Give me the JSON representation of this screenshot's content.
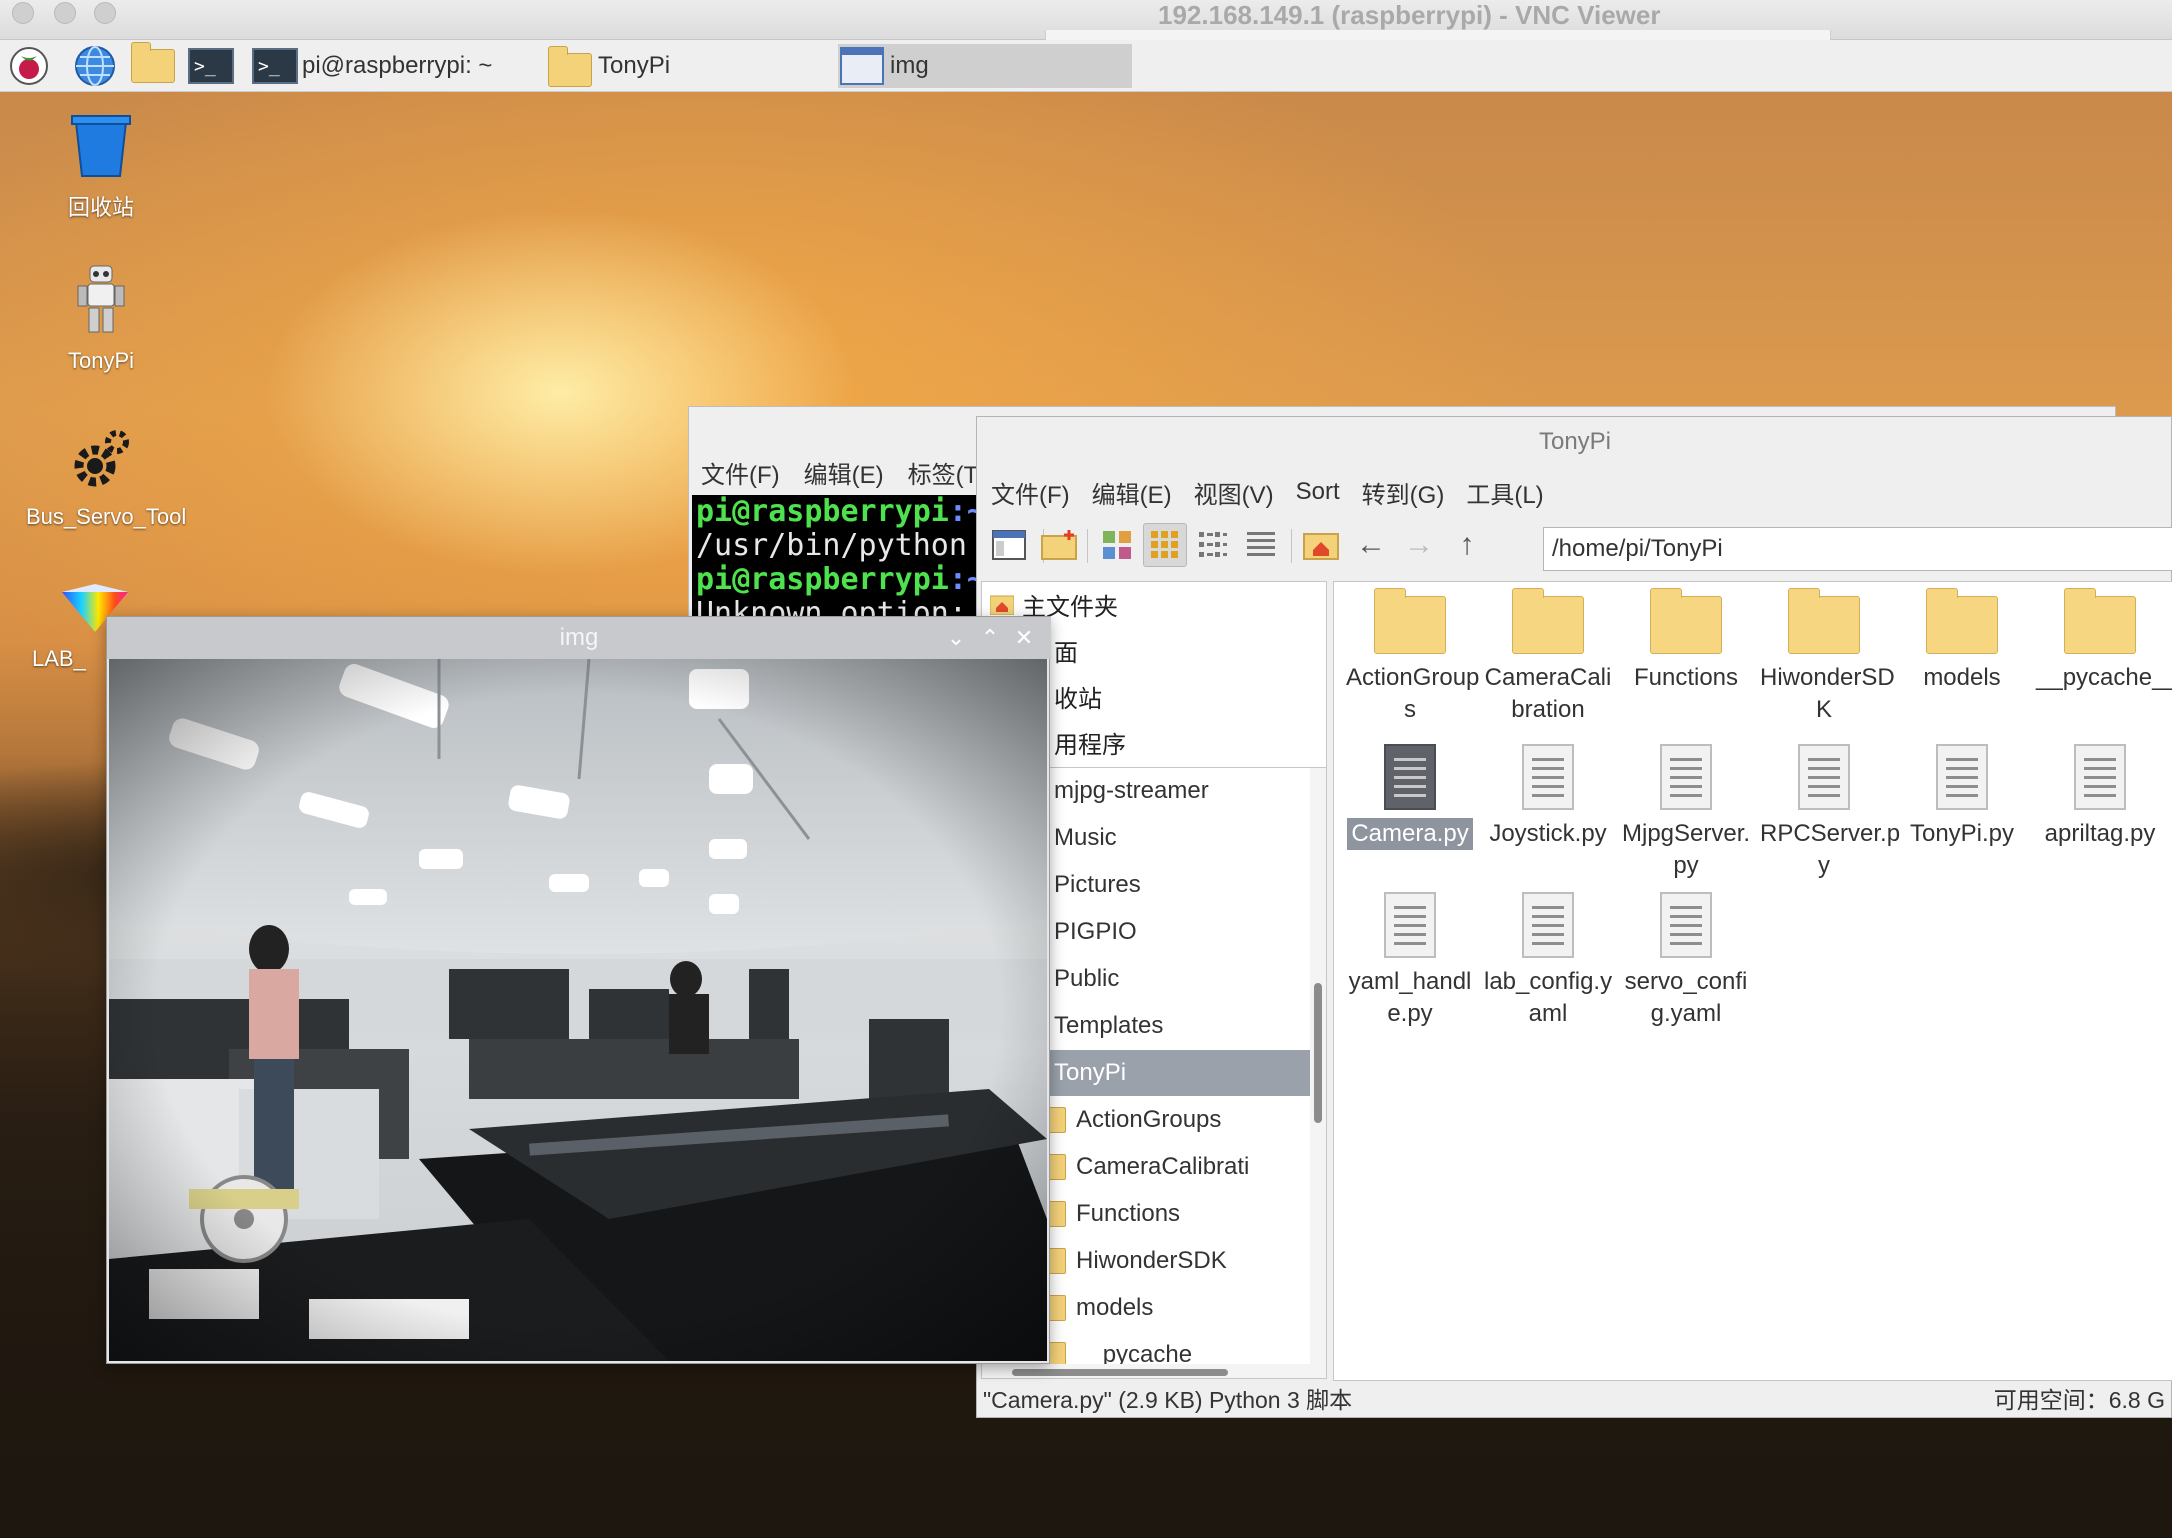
{
  "mac_window": {
    "title": "192.168.149.1 (raspberrypi) - VNC Viewer"
  },
  "taskbar": {
    "tasks": [
      {
        "label": "pi@raspberrypi: ~",
        "icon": "terminal-icon"
      },
      {
        "label": "TonyPi",
        "icon": "folder-icon"
      },
      {
        "label": "img",
        "icon": "window-icon"
      }
    ]
  },
  "desktop_icons": [
    {
      "label": "回收站",
      "icon": "trash-icon"
    },
    {
      "label": "TonyPi",
      "icon": "robot-icon"
    },
    {
      "label": "Bus_Servo_Tool",
      "icon": "gear-icon"
    },
    {
      "label": "LAB_",
      "icon": "prism-icon"
    }
  ],
  "terminal": {
    "menu": [
      "文件(F)",
      "编辑(E)",
      "标签(T)"
    ],
    "lines": [
      {
        "user": "pi@raspberrypi",
        "path": ":~"
      },
      {
        "text": "/usr/bin/python"
      },
      {
        "user": "pi@raspberrypi",
        "path": ":~"
      },
      {
        "text": "Unknown option:"
      }
    ]
  },
  "file_manager": {
    "title": "TonyPi",
    "menu": [
      "文件(F)",
      "编辑(E)",
      "视图(V)",
      "Sort",
      "转到(G)",
      "工具(L)"
    ],
    "address": "/home/pi/TonyPi",
    "places": [
      "主文件夹",
      "面",
      "收站",
      "用程序"
    ],
    "tree": [
      {
        "label": "mjpg-streamer",
        "expandable": true,
        "indent": 0
      },
      {
        "label": "Music",
        "expandable": false,
        "indent": 0,
        "glyph": "♪"
      },
      {
        "label": "Pictures",
        "expandable": false,
        "indent": 0,
        "glyph": "▲"
      },
      {
        "label": "PIGPIO",
        "expandable": true,
        "indent": 0
      },
      {
        "label": "Public",
        "expandable": false,
        "indent": 0,
        "glyph": "▪"
      },
      {
        "label": "Templates",
        "expandable": false,
        "indent": 0,
        "glyph": "▦"
      },
      {
        "label": "TonyPi",
        "expandable": true,
        "expanded": true,
        "indent": 0,
        "selected": true
      },
      {
        "label": "ActionGroups",
        "expandable": false,
        "indent": 1
      },
      {
        "label": "CameraCalibrati",
        "expandable": true,
        "indent": 1
      },
      {
        "label": "Functions",
        "expandable": true,
        "indent": 1
      },
      {
        "label": "HiwonderSDK",
        "expandable": true,
        "indent": 1
      },
      {
        "label": "models",
        "expandable": false,
        "indent": 1
      },
      {
        "label": "__pycache__",
        "expandable": false,
        "indent": 1
      }
    ],
    "files": [
      {
        "lines": [
          "ActionGroup",
          "s"
        ],
        "type": "folder"
      },
      {
        "lines": [
          "CameraCali",
          "bration"
        ],
        "type": "folder"
      },
      {
        "lines": [
          "Functions"
        ],
        "type": "folder"
      },
      {
        "lines": [
          "HiwonderSD",
          "K"
        ],
        "type": "folder"
      },
      {
        "lines": [
          "models"
        ],
        "type": "folder"
      },
      {
        "lines": [
          "__pycache__"
        ],
        "type": "folder"
      },
      {
        "lines": [
          "Camera.py"
        ],
        "type": "file",
        "selected": true
      },
      {
        "lines": [
          "Joystick.py"
        ],
        "type": "file"
      },
      {
        "lines": [
          "MjpgServer.",
          "py"
        ],
        "type": "file"
      },
      {
        "lines": [
          "RPCServer.p",
          "y"
        ],
        "type": "file"
      },
      {
        "lines": [
          "TonyPi.py"
        ],
        "type": "file"
      },
      {
        "lines": [
          "apriltag.py"
        ],
        "type": "file"
      },
      {
        "lines": [
          "yaml_handl",
          "e.py"
        ],
        "type": "file"
      },
      {
        "lines": [
          "lab_config.y",
          "aml"
        ],
        "type": "file"
      },
      {
        "lines": [
          "servo_confi",
          "g.yaml"
        ],
        "type": "file"
      }
    ],
    "status_left": "\"Camera.py\" (2.9 KB) Python 3 脚本",
    "status_right": "可用空间：6.8 G"
  },
  "img_window": {
    "title": "img",
    "controls": [
      "⌄",
      "⌃",
      "✕"
    ]
  },
  "colors": {
    "terminal_user": "#4ee34e",
    "terminal_path": "#6d8cff",
    "selection": "#8e959e",
    "folder": "#f6d680"
  }
}
